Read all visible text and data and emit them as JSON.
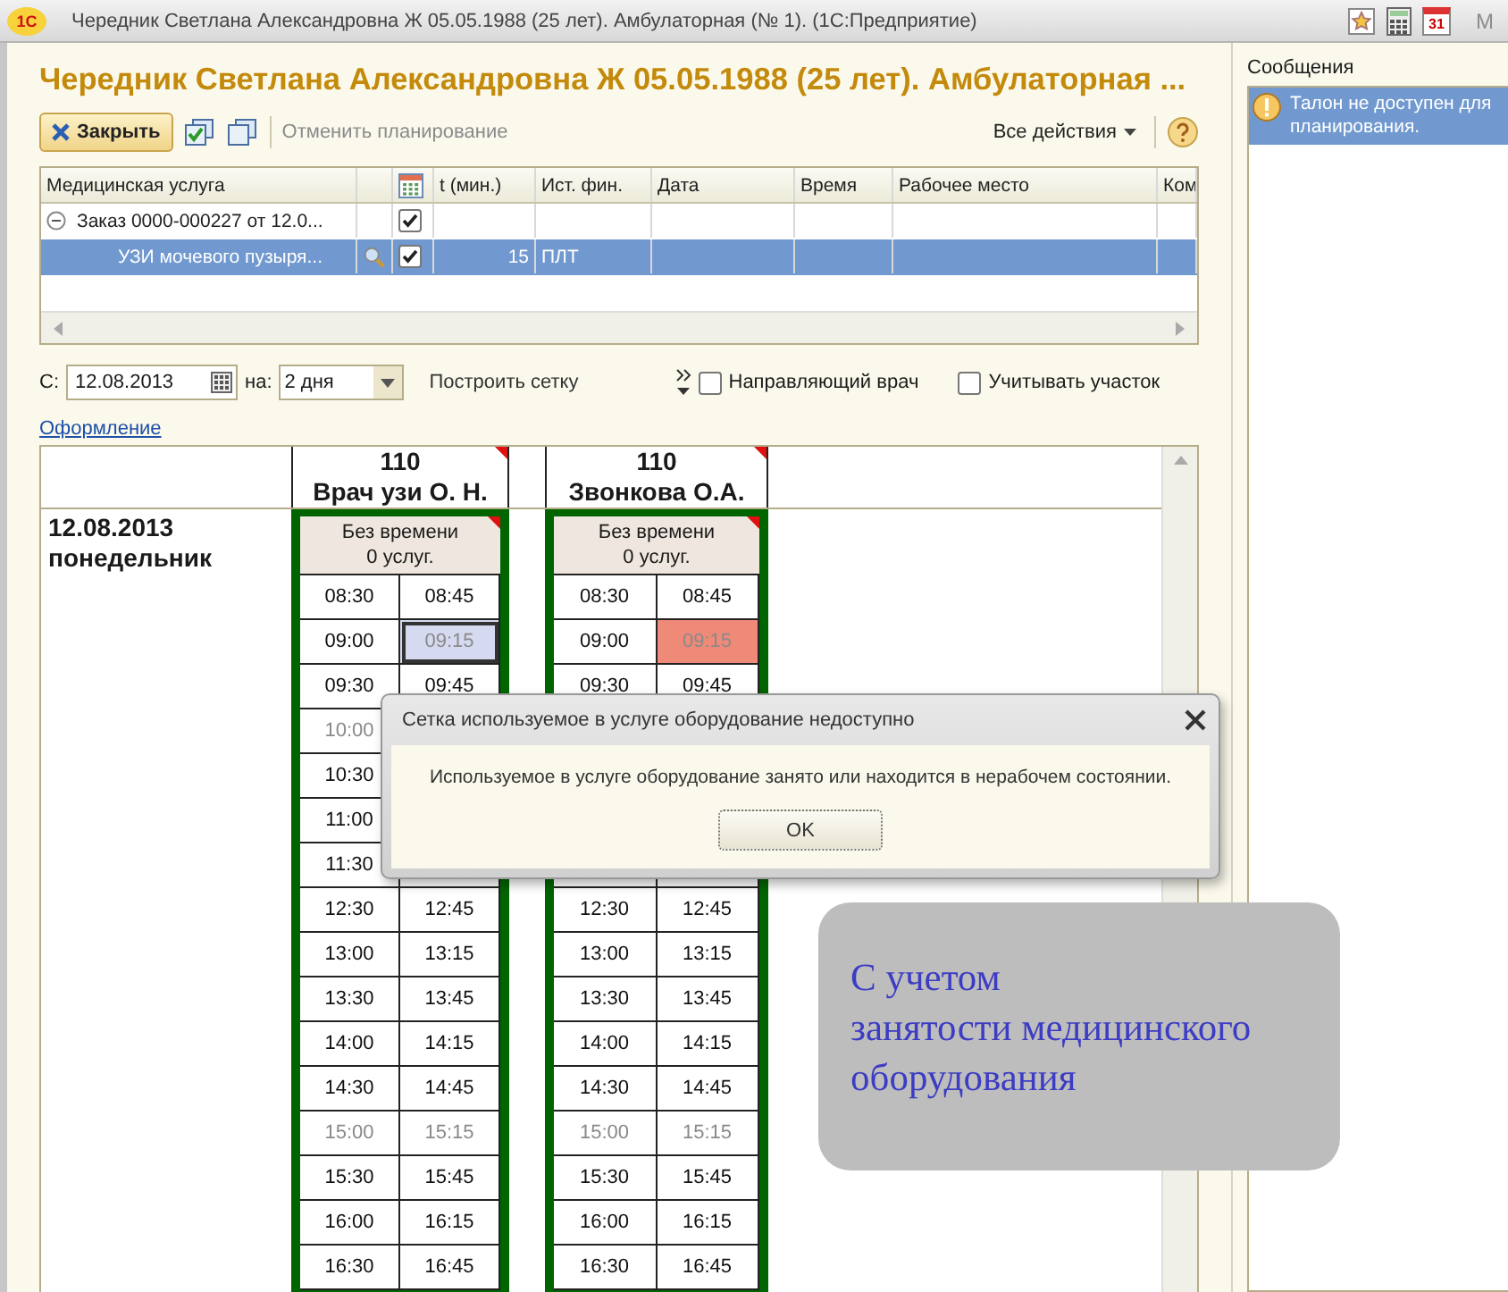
{
  "title_bar": {
    "logo": "1С",
    "title": "Чередник Светлана Александровна Ж 05.05.1988 (25 лет). Амбулаторная (№ 1).  (1С:Предприятие)",
    "tools": [
      {
        "kind": "favorite"
      },
      {
        "kind": "calculator"
      },
      {
        "kind": "calendar",
        "label": "31"
      },
      {
        "kind": "text",
        "label": "M",
        "disabled": true
      }
    ]
  },
  "form": {
    "title": "Чередник Светлана Александровна Ж 05.05.1988 (25 лет). Амбулаторная ...",
    "toolbar": {
      "close": "Закрыть",
      "cancel": "Отменить планирование",
      "all_actions": "Все действия"
    },
    "table": {
      "columns": [
        {
          "kind": "text",
          "label": "Медицинская услуга"
        },
        {
          "kind": "blank"
        },
        {
          "kind": "icon"
        },
        {
          "kind": "text",
          "label": "t (мин.)"
        },
        {
          "kind": "text",
          "label": "Ист. фин."
        },
        {
          "kind": "text",
          "label": "Дата"
        },
        {
          "kind": "text",
          "label": "Время"
        },
        {
          "kind": "text",
          "label": "Рабочее место"
        },
        {
          "kind": "text",
          "label": "Ком"
        }
      ],
      "rows": [
        {
          "kind": "group",
          "expanded": true,
          "service": "Заказ 0000-000227 от 12.0...",
          "checked": true,
          "selected": false
        },
        {
          "kind": "item",
          "service": "УЗИ мочевого пузыря...",
          "checked": true,
          "minutes": "15",
          "source": "ПЛТ",
          "selected": true
        }
      ]
    },
    "filter": {
      "from_label": "С:",
      "from": "12.08.2013",
      "days_label": "на:",
      "days": "2 дня",
      "build": "Построить сетку",
      "options": [
        {
          "label": "Направляющий врач",
          "checked": false
        },
        {
          "label": "Учитывать участок",
          "checked": false
        }
      ]
    },
    "link": "Оформление",
    "schedule": {
      "day": {
        "date": "12.08.2013",
        "weekday": "понедельник"
      },
      "doctors": [
        {
          "room": "110",
          "name": "Врач узи О. Н.",
          "no_time": "Без времени",
          "count": "0 услуг.",
          "rows": [
            [
              {
                "time": "08:30",
                "kind": "free",
                "selected": false
              },
              {
                "time": "08:45",
                "kind": "free",
                "selected": false
              }
            ],
            [
              {
                "time": "09:00",
                "kind": "free",
                "selected": false
              },
              {
                "time": "09:15",
                "kind": "free",
                "selected": true
              }
            ],
            [
              {
                "time": "09:30",
                "kind": "free",
                "selected": false
              },
              {
                "time": "09:45",
                "kind": "free",
                "selected": false
              }
            ],
            [
              {
                "time": "10:00",
                "kind": "unavailable",
                "selected": false
              }
            ],
            [
              {
                "time": "10:30",
                "kind": "free",
                "selected": false
              }
            ],
            [
              {
                "time": "11:00",
                "kind": "free",
                "selected": false
              }
            ],
            [
              {
                "time": "11:30",
                "kind": "free",
                "selected": false
              }
            ],
            [
              {
                "time": "12:30",
                "kind": "free",
                "selected": false
              },
              {
                "time": "12:45",
                "kind": "free",
                "selected": false
              }
            ],
            [
              {
                "time": "13:00",
                "kind": "free",
                "selected": false
              },
              {
                "time": "13:15",
                "kind": "free",
                "selected": false
              }
            ],
            [
              {
                "time": "13:30",
                "kind": "free",
                "selected": false
              },
              {
                "time": "13:45",
                "kind": "free",
                "selected": false
              }
            ],
            [
              {
                "time": "14:00",
                "kind": "free",
                "selected": false
              },
              {
                "time": "14:15",
                "kind": "free",
                "selected": false
              }
            ],
            [
              {
                "time": "14:30",
                "kind": "free",
                "selected": false
              },
              {
                "time": "14:45",
                "kind": "free",
                "selected": false
              }
            ],
            [
              {
                "time": "15:00",
                "kind": "unavailable",
                "selected": false
              },
              {
                "time": "15:15",
                "kind": "unavailable",
                "selected": false
              }
            ],
            [
              {
                "time": "15:30",
                "kind": "free",
                "selected": false
              },
              {
                "time": "15:45",
                "kind": "free",
                "selected": false
              }
            ],
            [
              {
                "time": "16:00",
                "kind": "free",
                "selected": false
              },
              {
                "time": "16:15",
                "kind": "free",
                "selected": false
              }
            ],
            [
              {
                "time": "16:30",
                "kind": "free",
                "selected": false
              },
              {
                "time": "16:45",
                "kind": "free",
                "selected": false
              }
            ]
          ]
        },
        {
          "room": "110",
          "name": "Звонкова О.А.",
          "no_time": "Без времени",
          "count": "0 услуг.",
          "rows": [
            [
              {
                "time": "08:30",
                "kind": "free",
                "selected": false
              },
              {
                "time": "08:45",
                "kind": "free",
                "selected": false
              }
            ],
            [
              {
                "time": "09:00",
                "kind": "free",
                "selected": false
              },
              {
                "time": "09:15",
                "kind": "busy",
                "selected": false
              }
            ],
            [
              {
                "time": "09:30",
                "kind": "free",
                "selected": false
              },
              {
                "time": "09:45",
                "kind": "free",
                "selected": false
              }
            ],
            [],
            [],
            [],
            [],
            [
              {
                "time": "12:30",
                "kind": "free",
                "selected": false
              },
              {
                "time": "12:45",
                "kind": "free",
                "selected": false
              }
            ],
            [
              {
                "time": "13:00",
                "kind": "free",
                "selected": false
              },
              {
                "time": "13:15",
                "kind": "free",
                "selected": false
              }
            ],
            [
              {
                "time": "13:30",
                "kind": "free",
                "selected": false
              },
              {
                "time": "13:45",
                "kind": "free",
                "selected": false
              }
            ],
            [
              {
                "time": "14:00",
                "kind": "free",
                "selected": false
              },
              {
                "time": "14:15",
                "kind": "free",
                "selected": false
              }
            ],
            [
              {
                "time": "14:30",
                "kind": "free",
                "selected": false
              },
              {
                "time": "14:45",
                "kind": "free",
                "selected": false
              }
            ],
            [
              {
                "time": "15:00",
                "kind": "unavailable",
                "selected": false
              },
              {
                "time": "15:15",
                "kind": "unavailable",
                "selected": false
              }
            ],
            [
              {
                "time": "15:30",
                "kind": "free",
                "selected": false
              },
              {
                "time": "15:45",
                "kind": "free",
                "selected": false
              }
            ],
            [
              {
                "time": "16:00",
                "kind": "free",
                "selected": false
              },
              {
                "time": "16:15",
                "kind": "free",
                "selected": false
              }
            ],
            [
              {
                "time": "16:30",
                "kind": "free",
                "selected": false
              },
              {
                "time": "16:45",
                "kind": "free",
                "selected": false
              }
            ]
          ]
        }
      ]
    }
  },
  "messages": {
    "title": "Сообщения",
    "items": [
      {
        "text": "Талон не доступен для планирования.",
        "selected": true
      }
    ]
  },
  "dialog": {
    "title": "Сетка используемое в услуге оборудование недоступно",
    "message": "Используемое в услуге оборудование занято или находится в нерабочем состоянии.",
    "ok": "OK"
  },
  "callout": {
    "lines": [
      "С учетом",
      "занятости медицинского",
      "оборудования"
    ]
  }
}
